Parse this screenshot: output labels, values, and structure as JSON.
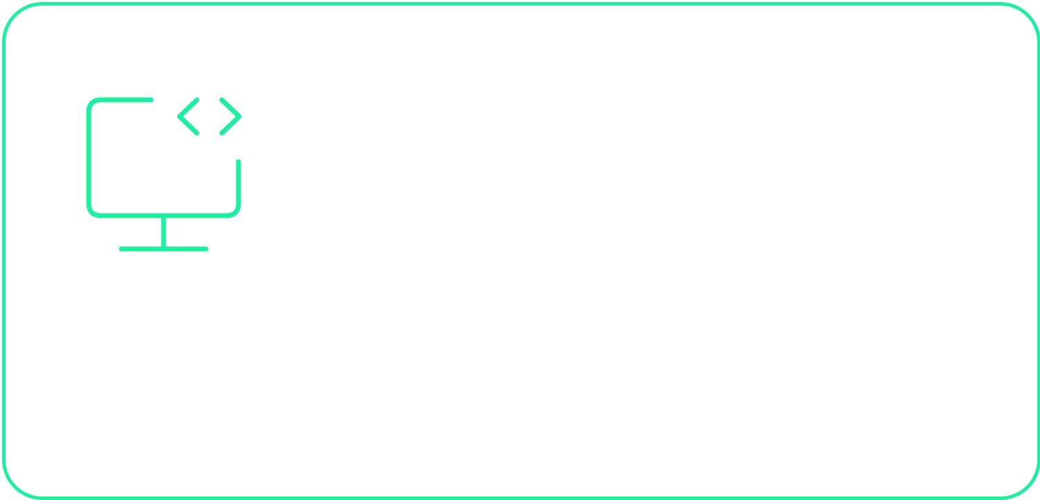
{
  "card": {
    "icon": "monitor-code-icon",
    "accent_color": "#1FEEA0"
  }
}
